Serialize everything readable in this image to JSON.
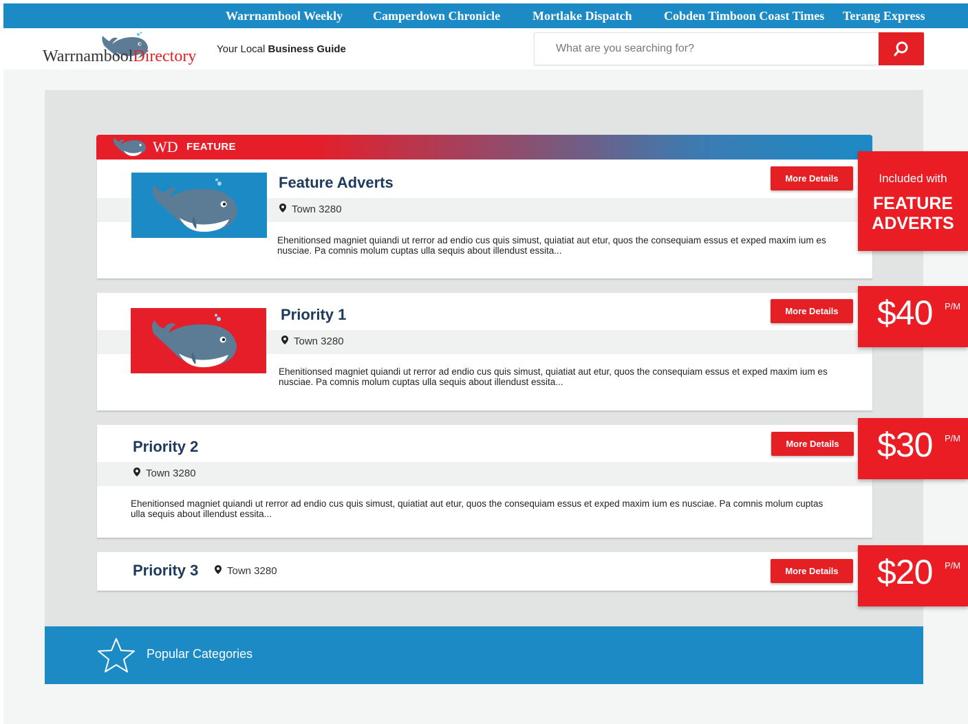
{
  "topnav": {
    "links": [
      "Warrnambool Weekly",
      "Camperdown Chronicle",
      "Mortlake Dispatch",
      "Cobden Timboon Coast Times",
      "Terang Express"
    ]
  },
  "header": {
    "logo_part1": "Warrnambool",
    "logo_part2": "Directory",
    "tagline_prefix": "Your Local ",
    "tagline_bold": "Business Guide",
    "search_placeholder": "What are you searching for?"
  },
  "feature_bar": {
    "wd": "WD",
    "label": "FEATURE"
  },
  "listings": [
    {
      "title": "Feature Adverts",
      "location": "Town 3280",
      "description": "Ehenitionsed magniet quiandi ut rerror ad endio cus quis simust, quiatiat aut etur, quos the  consequiam essus et exped maxim ium es nusciae. Pa comnis molum cuptas ulla sequis about illendust essita...",
      "button": "More Details",
      "thumb_color": "#1b8ac5"
    },
    {
      "title": "Priority 1",
      "location": "Town 3280",
      "description": "Ehenitionsed magniet quiandi ut rerror ad endio cus quis simust, quiatiat aut etur, quos the  consequiam essus et exped maxim ium es nusciae. Pa comnis molum cuptas ulla sequis about illendust essita...",
      "button": "More Details",
      "thumb_color": "#e61e2a"
    },
    {
      "title": "Priority 2",
      "location": "Town 3280",
      "description": "Ehenitionsed magniet quiandi ut rerror ad endio cus quis simust, quiatiat aut etur, quos the  consequiam essus et exped maxim ium es nusciae. Pa comnis molum cuptas ulla sequis about illendust essita...",
      "button": "More Details"
    },
    {
      "title": "Priority 3",
      "location": "Town 3280",
      "button": "More Details"
    }
  ],
  "pricing": {
    "included_line": "Included with",
    "included_big": "FEATURE ADVERTS",
    "prices": [
      "$40",
      "$30",
      "$20"
    ],
    "per_month": "P/M"
  },
  "footer": {
    "popular_categories": "Popular Categories"
  },
  "colors": {
    "brand_blue": "#1b8ac5",
    "brand_red": "#e52024",
    "title_navy": "#1d3a5c"
  },
  "icons": {
    "search": "magnifier-icon",
    "pin": "map-pin-icon",
    "star": "star-outline-icon",
    "whale": "whale-icon"
  }
}
